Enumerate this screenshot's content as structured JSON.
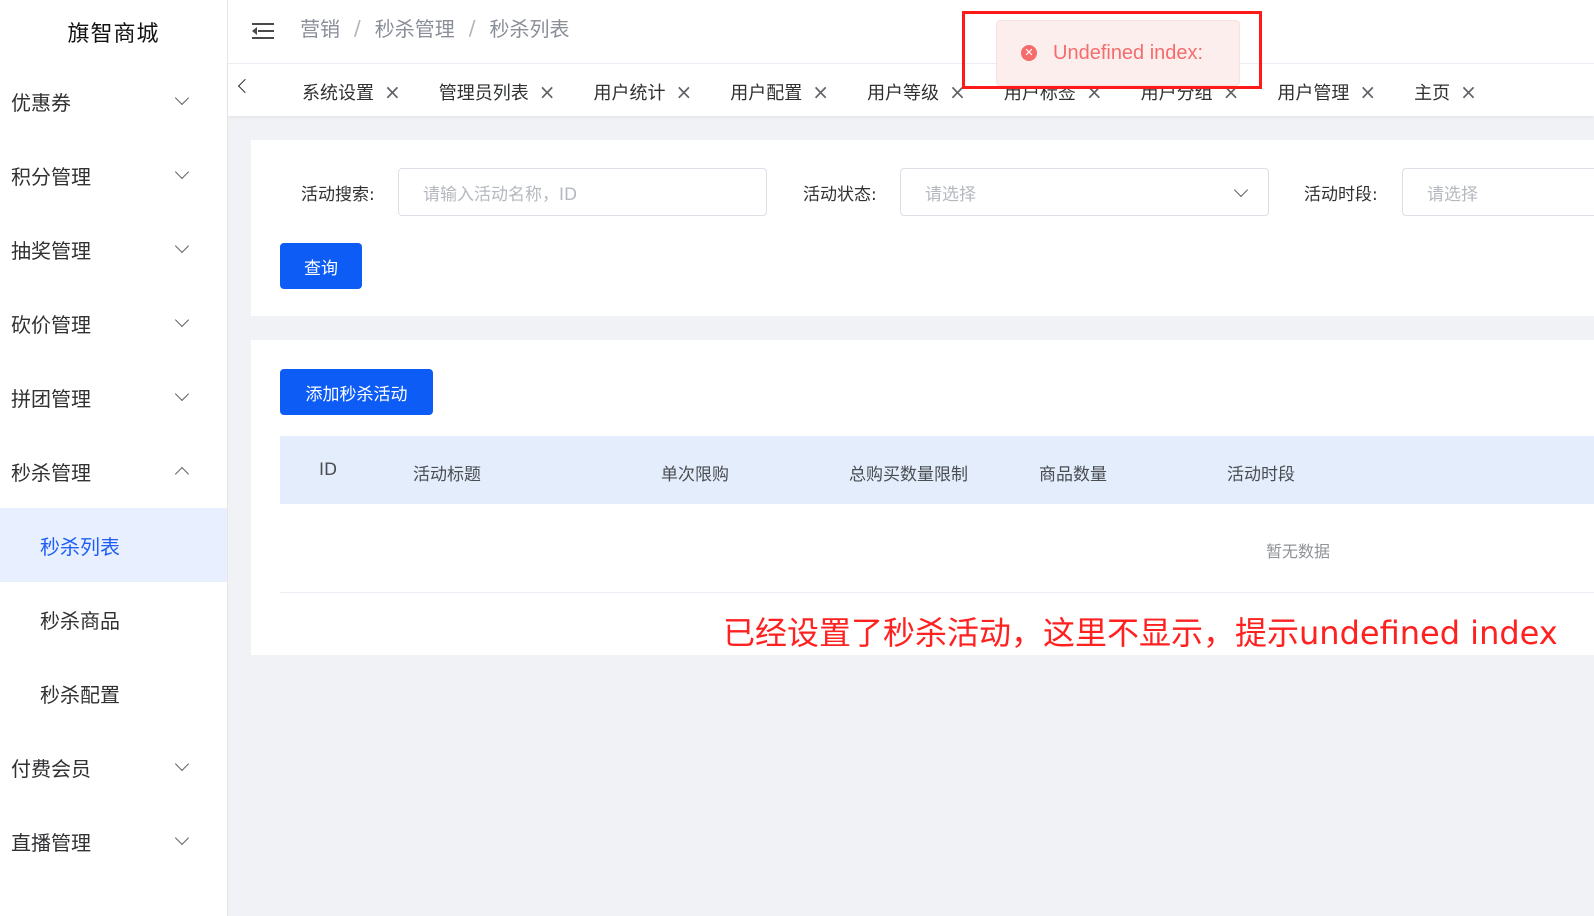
{
  "sidebar": {
    "logo": "旗智商城",
    "items": [
      {
        "label": "优惠券"
      },
      {
        "label": "积分管理"
      },
      {
        "label": "抽奖管理"
      },
      {
        "label": "砍价管理"
      },
      {
        "label": "拼团管理"
      },
      {
        "label": "秒杀管理",
        "expanded": true
      },
      {
        "label": "付费会员"
      },
      {
        "label": "直播管理"
      }
    ],
    "sub_items": [
      {
        "label": "秒杀列表",
        "active": true
      },
      {
        "label": "秒杀商品"
      },
      {
        "label": "秒杀配置"
      }
    ]
  },
  "header": {
    "breadcrumb": [
      "营销",
      "秒杀管理",
      "秒杀列表"
    ],
    "separator": "/"
  },
  "tabs": [
    {
      "label": "系统设置"
    },
    {
      "label": "管理员列表"
    },
    {
      "label": "用户统计"
    },
    {
      "label": "用户配置"
    },
    {
      "label": "用户等级"
    },
    {
      "label": "用户标签"
    },
    {
      "label": "用户分组"
    },
    {
      "label": "用户管理"
    },
    {
      "label": "主页"
    }
  ],
  "tab_close": "×",
  "toast": {
    "icon": "error-circle-icon",
    "text": "Undefined index:",
    "color": "#f56c6c"
  },
  "search": {
    "name_label": "活动搜索:",
    "name_placeholder": "请输入活动名称，ID",
    "status_label": "活动状态:",
    "status_placeholder": "请选择",
    "period_label": "活动时段:",
    "period_placeholder": "请选择",
    "query_button": "查询"
  },
  "table": {
    "add_button": "添加秒杀活动",
    "columns": [
      "ID",
      "活动标题",
      "单次限购",
      "总购买数量限制",
      "商品数量",
      "活动时段"
    ],
    "empty_text": "暂无数据"
  },
  "annotation": "已经设置了秒杀活动，这里不显示，提示undefined index",
  "colors": {
    "primary": "#0d5cf5",
    "active_menu_bg": "#e8f0ff",
    "table_header_bg": "#e4edfc",
    "annotation": "#ff2020"
  }
}
